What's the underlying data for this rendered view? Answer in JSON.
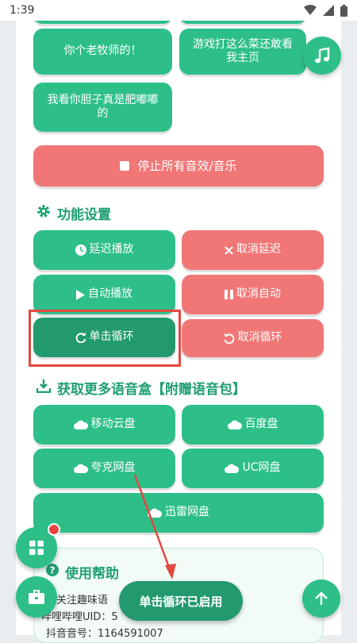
{
  "status": {
    "time": "1:39"
  },
  "sounds": [
    {
      "label": "你个老牧师的！"
    },
    {
      "label": "游戏打这么菜还敢看我主页"
    },
    {
      "label": "我看你胆子真是肥嘟嘟的"
    }
  ],
  "stop_all": {
    "label": "停止所有音效/音乐"
  },
  "settings": {
    "title": "功能设置",
    "buttons": [
      {
        "label": "延迟播放",
        "icon": "clock-icon"
      },
      {
        "label": "取消延迟",
        "icon": "close-icon"
      },
      {
        "label": "自动播放",
        "icon": "play-icon"
      },
      {
        "label": "取消自动",
        "icon": "pause-icon"
      },
      {
        "label": "单击循环",
        "icon": "redo-icon"
      },
      {
        "label": "取消循环",
        "icon": "undo-icon"
      }
    ]
  },
  "downloads": {
    "title": "获取更多语音盒【附赠语音包】",
    "buttons": [
      {
        "label": "移动云盘",
        "icon": "cloud-icon"
      },
      {
        "label": "百度盘",
        "icon": "cloud-icon"
      },
      {
        "label": "夸克网盘",
        "icon": "cloud-icon"
      },
      {
        "label": "UC网盘",
        "icon": "cloud-icon"
      },
      {
        "label": "迅雷网盘",
        "icon": "cloud-icon"
      }
    ]
  },
  "help": {
    "title": "使用帮助",
    "line1": "迎关注趣味语",
    "line2": "哔哩哔哩UID：5",
    "line3": "抖音音号：1164591007"
  },
  "toast": {
    "text": "单击循环已启用"
  },
  "colors": {
    "green": "#2ebf89",
    "dark_green": "#239a6d",
    "red": "#f17777",
    "accent_text": "#1e9f70"
  }
}
